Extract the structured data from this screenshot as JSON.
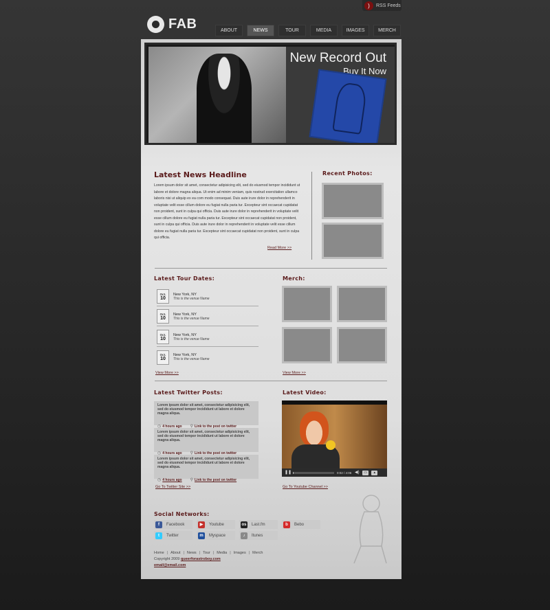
{
  "rss": {
    "label": "RSS Feeds"
  },
  "logo": {
    "name": "FAB"
  },
  "nav": {
    "tabs": [
      {
        "label": "About"
      },
      {
        "label": "News"
      },
      {
        "label": "Tour"
      },
      {
        "label": "Media"
      },
      {
        "label": "Images"
      },
      {
        "label": "Merch"
      }
    ],
    "active": "News"
  },
  "hero": {
    "headline": "New Record Out",
    "subline": "Buy It Now"
  },
  "news": {
    "title": "Latest News Headline",
    "body": "Lorem ipsum dolor sit amet, consectetur adipisicing elit, sed do eiusmod tempor incididunt ut labore et dolore magna aliqua. Ut enim ad minim veniam, quis nostrud exercitation ullamco laboris nisi ut aliquip ex ea com modo consequat. Duis aute irure dolor in reprehenderit in voluptate velit esse cillum dolore eu fugiat nulla paria tur. Excepteur sint occaecat cupidatat non proident, sunt in culpa qui officia. Duis aute irure dolor in reprehenderit in voluptate velit esse cillum dolore eu fugiat nulla paria tur. Excepteur sint occaecat cupidatat non proident, sunt in culpa qui officia. Duis aute irure dolor in reprehenderit in voluptate velit esse cillum dolore eu fugiat nulla paria tur. Excepteur sint occaecat cupidatat non proident, sunt in culpa qui officia.",
    "more": "Read More >>"
  },
  "photos": {
    "title": "Recent Photos:"
  },
  "tour": {
    "title": "Latest Tour Dates:",
    "rows": [
      {
        "month": "Oct.",
        "day": "10",
        "city": "New York, NY",
        "venue": "This is the venue Name"
      },
      {
        "month": "Oct.",
        "day": "10",
        "city": "New York, NY",
        "venue": "This is the venue Name"
      },
      {
        "month": "Oct.",
        "day": "10",
        "city": "New York, NY",
        "venue": "This is the venue Name"
      },
      {
        "month": "Oct.",
        "day": "10",
        "city": "New York, NY",
        "venue": "This is the venue Name"
      }
    ],
    "more": "View More >>"
  },
  "merch": {
    "title": "Merch:",
    "more": "View More >>"
  },
  "twitter": {
    "title": "Latest Twitter Posts:",
    "posts": [
      {
        "text": "Lorem ipsum dolor sit amet, consectetur adipisicing elit, sed do eiusmod tempor incididunt ut labore et dolore magna aliqua.",
        "time": "4 hours ago",
        "link": "Link to the post on twitter"
      },
      {
        "text": "Lorem ipsum dolor sit amet, consectetur adipisicing elit, sed do eiusmod tempor incididunt ut labore et dolore magna aliqua.",
        "time": "4 hours ago",
        "link": "Link to the post on twitter"
      },
      {
        "text": "Lorem ipsum dolor sit amet, consectetur adipisicing elit, sed do eiusmod tempor incididunt ut labore et dolore magna aliqua.",
        "time": "4 hours ago",
        "link": "Link to the post on twitter"
      }
    ],
    "more": "Go To Twitter Site >>"
  },
  "video": {
    "title": "Latest Video:",
    "time": "0:02 / 4:06",
    "progress": 0.01,
    "more": "Go To Youtube Channel >>"
  },
  "social": {
    "title": "Social Networks:",
    "items": [
      {
        "label": "Facebook",
        "icon": "facebook-icon",
        "color": "#3b5998",
        "glyph": "f"
      },
      {
        "label": "Youtube",
        "icon": "youtube-icon",
        "color": "#c4302b",
        "glyph": "▶"
      },
      {
        "label": "Last.fm",
        "icon": "lastfm-icon",
        "color": "#222222",
        "glyph": "os"
      },
      {
        "label": "Bebo",
        "icon": "bebo-icon",
        "color": "#d42b2b",
        "glyph": "b"
      },
      {
        "label": "Twitter",
        "icon": "twitter-icon",
        "color": "#33ccff",
        "glyph": "t"
      },
      {
        "label": "Myspace",
        "icon": "myspace-icon",
        "color": "#1f4f9c",
        "glyph": "m"
      },
      {
        "label": "Itunes",
        "icon": "itunes-icon",
        "color": "#8a8a8a",
        "glyph": "♪"
      }
    ]
  },
  "footer": {
    "links": [
      "Home",
      "About",
      "News",
      "Tour",
      "Media",
      "Images",
      "Merch"
    ],
    "separator": "|",
    "copyright": "Copyright 2009",
    "copyright_link": "queerforastroboy.com",
    "email": "email@email.com"
  }
}
